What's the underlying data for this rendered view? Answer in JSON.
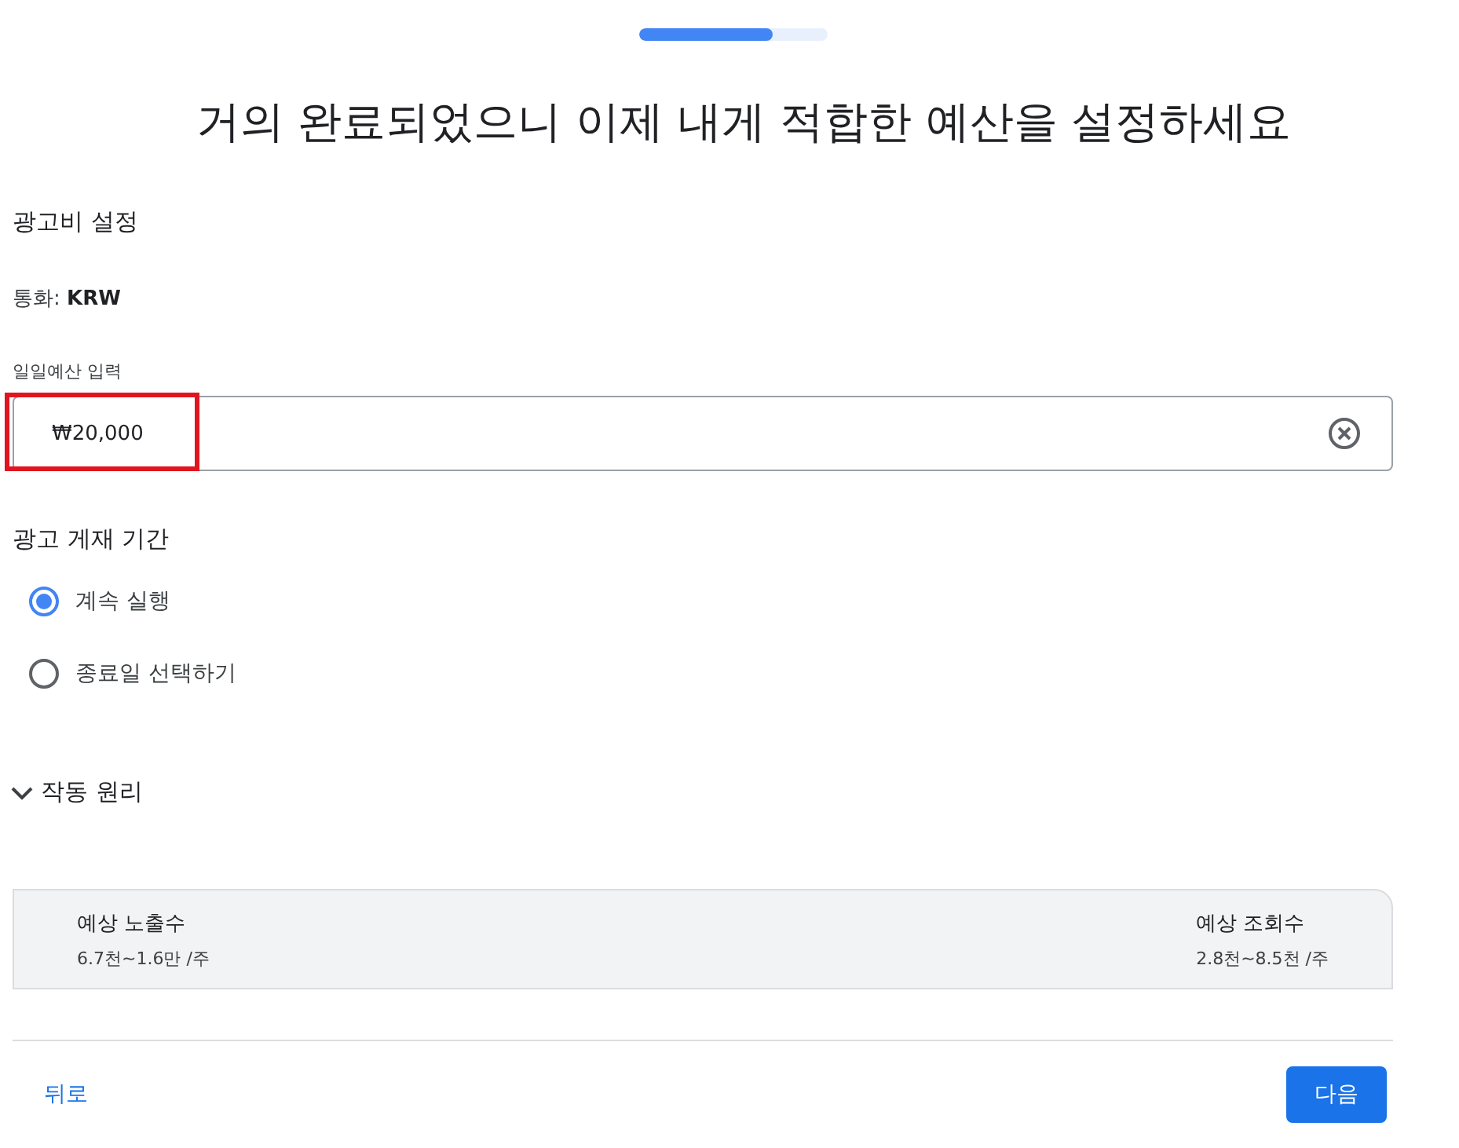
{
  "progress": {
    "level": 0.71
  },
  "title": "거의 완료되었으니 이제 내게 적합한 예산을 설정하세요",
  "budget_section": {
    "heading": "광고비 설정",
    "currency_label": "통화:",
    "currency": "KRW",
    "field_label": "일일예산 입력",
    "value": "₩20,000"
  },
  "duration_section": {
    "heading": "광고 게재 기간",
    "options": [
      {
        "label": "계속 실행",
        "selected": true
      },
      {
        "label": "종료일 선택하기",
        "selected": false
      }
    ]
  },
  "how_it_works": {
    "label": "작동 원리",
    "expanded": false
  },
  "estimates": [
    {
      "label": "예상 노출수",
      "value": "6.7천~1.6만 /주"
    },
    {
      "label": "예상 조회수",
      "value": "2.8천~8.5천 /주"
    }
  ],
  "buttons": {
    "back": "뒤로",
    "next": "다음"
  }
}
